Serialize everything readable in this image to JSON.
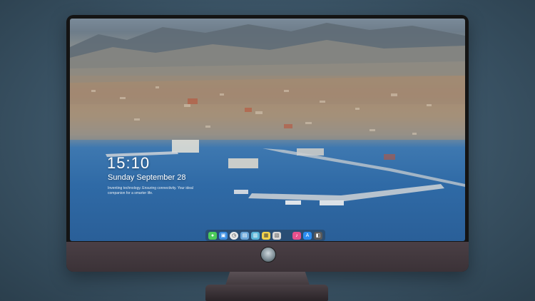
{
  "lockscreen": {
    "time": "15:10",
    "date": "Sunday September 28",
    "tagline": "Inventing technology. Ensuring connectivity. Your ideal companion for a smarter life."
  },
  "dock": {
    "items": [
      {
        "name": "messages-icon",
        "color": "#4ccb5a"
      },
      {
        "name": "finder-icon",
        "color": "#3b8de0"
      },
      {
        "name": "clock-icon",
        "color": "#e9e9e9"
      },
      {
        "name": "preview-icon",
        "color": "#6aa6d8"
      },
      {
        "name": "files-icon",
        "color": "#5bb5d9"
      },
      {
        "name": "notes-icon",
        "color": "#f2d24a"
      },
      {
        "name": "photos-icon",
        "color": "#d7d7d7"
      },
      {
        "name": "music-icon",
        "color": "#e8508c"
      },
      {
        "name": "app-store-icon",
        "color": "#2a8cf0"
      },
      {
        "name": "system-icon",
        "color": "#5a5a5a"
      }
    ]
  }
}
